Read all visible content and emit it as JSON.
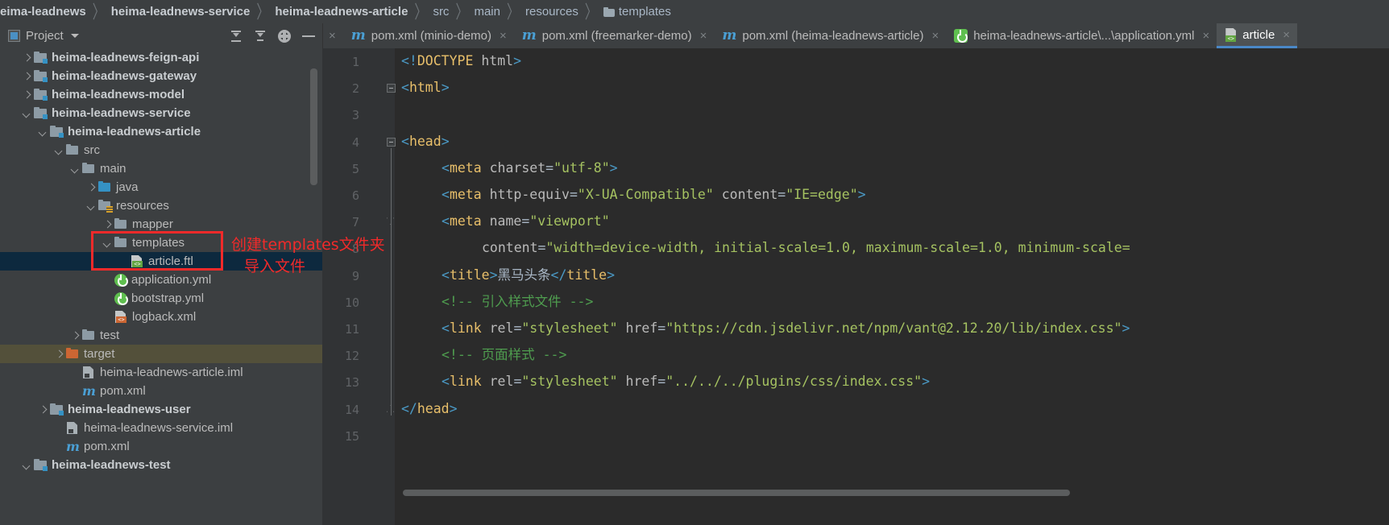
{
  "breadcrumb": {
    "name": "breadcrumb",
    "items": [
      {
        "label": "eima-leadnews",
        "bold": true,
        "folder": false
      },
      {
        "label": "heima-leadnews-service",
        "bold": true,
        "folder": false
      },
      {
        "label": "heima-leadnews-article",
        "bold": true,
        "folder": false
      },
      {
        "label": "src",
        "bold": false,
        "folder": false
      },
      {
        "label": "main",
        "bold": false,
        "folder": false
      },
      {
        "label": "resources",
        "bold": false,
        "folder": false
      },
      {
        "label": "templates",
        "bold": false,
        "folder": true
      }
    ]
  },
  "toolwindow": {
    "title": "Project",
    "caret": "▾",
    "actions": [
      {
        "name": "expand-all-icon",
        "title": "Expand All"
      },
      {
        "name": "collapse-all-icon",
        "title": "Collapse All"
      },
      {
        "name": "gear-icon",
        "title": "Settings"
      },
      {
        "name": "minimize-icon",
        "title": "Hide"
      }
    ]
  },
  "editor_tabs": [
    {
      "label": "pom.xml (minio-demo)",
      "icon": "maven-icon",
      "close": "×",
      "active": false
    },
    {
      "label": "pom.xml (freemarker-demo)",
      "icon": "maven-icon",
      "close": "×",
      "active": false
    },
    {
      "label": "pom.xml (heima-leadnews-article)",
      "icon": "maven-icon",
      "close": "×",
      "active": false
    },
    {
      "label": "heima-leadnews-article\\...\\application.yml",
      "icon": "spring-yaml-icon",
      "close": "×",
      "active": false
    },
    {
      "label": "article",
      "icon": "ftl-file-icon",
      "close": "×",
      "active": true
    }
  ],
  "tree": {
    "rows": [
      {
        "indent": 1,
        "arrow": "right",
        "icon": "module-icon",
        "label": "heima-leadnews-feign-api",
        "bold": true,
        "state": "none"
      },
      {
        "indent": 1,
        "arrow": "right",
        "icon": "module-icon",
        "label": "heima-leadnews-gateway",
        "bold": true,
        "state": "none"
      },
      {
        "indent": 1,
        "arrow": "right",
        "icon": "module-icon",
        "label": "heima-leadnews-model",
        "bold": true,
        "state": "none"
      },
      {
        "indent": 1,
        "arrow": "down",
        "icon": "module-icon",
        "label": "heima-leadnews-service",
        "bold": true,
        "state": "none"
      },
      {
        "indent": 2,
        "arrow": "down",
        "icon": "module-icon",
        "label": "heima-leadnews-article",
        "bold": true,
        "state": "none"
      },
      {
        "indent": 3,
        "arrow": "down",
        "icon": "folder-icon",
        "label": "src",
        "bold": false,
        "state": "none"
      },
      {
        "indent": 4,
        "arrow": "down",
        "icon": "folder-icon",
        "label": "main",
        "bold": false,
        "state": "none"
      },
      {
        "indent": 5,
        "arrow": "right",
        "icon": "source-root-icon",
        "label": "java",
        "bold": false,
        "state": "none"
      },
      {
        "indent": 5,
        "arrow": "down",
        "icon": "resource-root-icon",
        "label": "resources",
        "bold": false,
        "state": "none"
      },
      {
        "indent": 6,
        "arrow": "right",
        "icon": "folder-icon",
        "label": "mapper",
        "bold": false,
        "state": "none"
      },
      {
        "indent": 6,
        "arrow": "down",
        "icon": "folder-icon",
        "label": "templates",
        "bold": false,
        "state": "none"
      },
      {
        "indent": 7,
        "arrow": "none",
        "icon": "ftl-file-icon",
        "label": "article.ftl",
        "bold": false,
        "state": "selected"
      },
      {
        "indent": 6,
        "arrow": "none",
        "icon": "spring-yaml-icon",
        "label": "application.yml",
        "bold": false,
        "state": "none"
      },
      {
        "indent": 6,
        "arrow": "none",
        "icon": "spring-yaml-icon",
        "label": "bootstrap.yml",
        "bold": false,
        "state": "none"
      },
      {
        "indent": 6,
        "arrow": "none",
        "icon": "xml-file-icon",
        "label": "logback.xml",
        "bold": false,
        "state": "none"
      },
      {
        "indent": 4,
        "arrow": "right",
        "icon": "folder-icon",
        "label": "test",
        "bold": false,
        "state": "none"
      },
      {
        "indent": 3,
        "arrow": "right",
        "icon": "excluded-folder-icon",
        "label": "target",
        "bold": false,
        "state": "highlight"
      },
      {
        "indent": 4,
        "arrow": "none",
        "icon": "iml-file-icon",
        "label": "heima-leadnews-article.iml",
        "bold": false,
        "state": "none"
      },
      {
        "indent": 4,
        "arrow": "none",
        "icon": "maven-icon",
        "label": "pom.xml",
        "bold": false,
        "state": "none"
      },
      {
        "indent": 2,
        "arrow": "right",
        "icon": "module-icon",
        "label": "heima-leadnews-user",
        "bold": true,
        "state": "none"
      },
      {
        "indent": 3,
        "arrow": "none",
        "icon": "iml-file-icon",
        "label": "heima-leadnews-service.iml",
        "bold": false,
        "state": "none"
      },
      {
        "indent": 3,
        "arrow": "none",
        "icon": "maven-icon",
        "label": "pom.xml",
        "bold": false,
        "state": "none"
      },
      {
        "indent": 1,
        "arrow": "down",
        "icon": "module-icon",
        "label": "heima-leadnews-test",
        "bold": true,
        "state": "none"
      }
    ]
  },
  "code": {
    "lines": [
      {
        "num": 1,
        "indent": 0,
        "fold": "none",
        "tokens": [
          {
            "t": "brk",
            "v": "<!"
          },
          {
            "t": "tag",
            "v": "DOCTYPE"
          },
          {
            "t": "plain",
            "v": " "
          },
          {
            "t": "attr",
            "v": "html"
          },
          {
            "t": "brk",
            "v": ">"
          }
        ]
      },
      {
        "num": 2,
        "indent": 0,
        "fold": "minus",
        "tokens": [
          {
            "t": "brk",
            "v": "<"
          },
          {
            "t": "tag",
            "v": "html"
          },
          {
            "t": "brk",
            "v": ">"
          }
        ]
      },
      {
        "num": 3,
        "indent": 0,
        "fold": "none",
        "tokens": []
      },
      {
        "num": 4,
        "indent": 0,
        "fold": "minus",
        "tokens": [
          {
            "t": "brk",
            "v": "<"
          },
          {
            "t": "tag",
            "v": "head"
          },
          {
            "t": "brk",
            "v": ">"
          }
        ]
      },
      {
        "num": 5,
        "indent": 1,
        "fold": "none",
        "tokens": [
          {
            "t": "brk",
            "v": "<"
          },
          {
            "t": "tag",
            "v": "meta"
          },
          {
            "t": "plain",
            "v": " "
          },
          {
            "t": "attr",
            "v": "charset"
          },
          {
            "t": "plain",
            "v": "="
          },
          {
            "t": "val",
            "v": "\"utf-8\""
          },
          {
            "t": "brk",
            "v": ">"
          }
        ]
      },
      {
        "num": 6,
        "indent": 1,
        "fold": "none",
        "tokens": [
          {
            "t": "brk",
            "v": "<"
          },
          {
            "t": "tag",
            "v": "meta"
          },
          {
            "t": "plain",
            "v": " "
          },
          {
            "t": "attr",
            "v": "http-equiv"
          },
          {
            "t": "plain",
            "v": "="
          },
          {
            "t": "val",
            "v": "\"X-UA-Compatible\""
          },
          {
            "t": "plain",
            "v": " "
          },
          {
            "t": "attr",
            "v": "content"
          },
          {
            "t": "plain",
            "v": "="
          },
          {
            "t": "val",
            "v": "\"IE=edge\""
          },
          {
            "t": "brk",
            "v": ">"
          }
        ]
      },
      {
        "num": 7,
        "indent": 1,
        "fold": "tip",
        "tokens": [
          {
            "t": "brk",
            "v": "<"
          },
          {
            "t": "tag",
            "v": "meta"
          },
          {
            "t": "plain",
            "v": " "
          },
          {
            "t": "attr",
            "v": "name"
          },
          {
            "t": "plain",
            "v": "="
          },
          {
            "t": "val",
            "v": "\"viewport\""
          }
        ]
      },
      {
        "num": 8,
        "indent": 2,
        "fold": "none",
        "tokens": [
          {
            "t": "attr",
            "v": "content"
          },
          {
            "t": "plain",
            "v": "="
          },
          {
            "t": "val",
            "v": "\"width=device-width, initial-scale=1.0, maximum-scale=1.0, minimum-scale="
          }
        ]
      },
      {
        "num": 9,
        "indent": 1,
        "fold": "none",
        "tokens": [
          {
            "t": "brk",
            "v": "<"
          },
          {
            "t": "tag",
            "v": "title"
          },
          {
            "t": "brk",
            "v": ">"
          },
          {
            "t": "text",
            "v": "黑马头条"
          },
          {
            "t": "brk",
            "v": "</"
          },
          {
            "t": "tag",
            "v": "title"
          },
          {
            "t": "brk",
            "v": ">"
          }
        ]
      },
      {
        "num": 10,
        "indent": 1,
        "fold": "none",
        "tokens": [
          {
            "t": "comment",
            "v": "<!-- 引入样式文件 -->"
          }
        ]
      },
      {
        "num": 11,
        "indent": 1,
        "fold": "none",
        "tokens": [
          {
            "t": "brk",
            "v": "<"
          },
          {
            "t": "tag",
            "v": "link"
          },
          {
            "t": "plain",
            "v": " "
          },
          {
            "t": "attr",
            "v": "rel"
          },
          {
            "t": "plain",
            "v": "="
          },
          {
            "t": "val",
            "v": "\"stylesheet\""
          },
          {
            "t": "plain",
            "v": " "
          },
          {
            "t": "attr",
            "v": "href"
          },
          {
            "t": "plain",
            "v": "="
          },
          {
            "t": "val",
            "v": "\"https://cdn.jsdelivr.net/npm/vant@2.12.20/lib/index.css\""
          },
          {
            "t": "brk",
            "v": ">"
          }
        ]
      },
      {
        "num": 12,
        "indent": 1,
        "fold": "none",
        "tokens": [
          {
            "t": "comment",
            "v": "<!-- 页面样式 -->"
          }
        ]
      },
      {
        "num": 13,
        "indent": 1,
        "fold": "none",
        "tokens": [
          {
            "t": "brk",
            "v": "<"
          },
          {
            "t": "tag",
            "v": "link"
          },
          {
            "t": "plain",
            "v": " "
          },
          {
            "t": "attr",
            "v": "rel"
          },
          {
            "t": "plain",
            "v": "="
          },
          {
            "t": "val",
            "v": "\"stylesheet\""
          },
          {
            "t": "plain",
            "v": " "
          },
          {
            "t": "attr",
            "v": "href"
          },
          {
            "t": "plain",
            "v": "="
          },
          {
            "t": "val",
            "v": "\"../../../plugins/css/index.css\""
          },
          {
            "t": "brk",
            "v": ">"
          }
        ]
      },
      {
        "num": 14,
        "indent": 0,
        "fold": "end",
        "tokens": [
          {
            "t": "brk",
            "v": "</"
          },
          {
            "t": "tag",
            "v": "head"
          },
          {
            "t": "brk",
            "v": ">"
          }
        ]
      },
      {
        "num": 15,
        "indent": 0,
        "fold": "none",
        "tokens": []
      }
    ]
  },
  "annotation": {
    "line1": "创建templates文件夹",
    "line2": "导入文件",
    "color": "#f12a2a"
  }
}
